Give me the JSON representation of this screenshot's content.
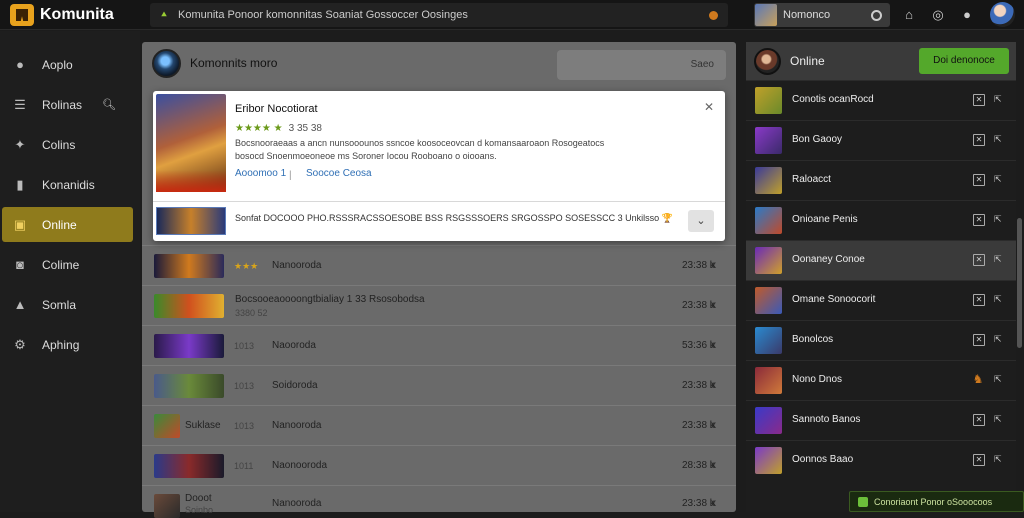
{
  "app": {
    "title": "Komunita"
  },
  "notice": {
    "lead": "⯅",
    "text": "Komunita Ponoor komonnitas Soaniat Gossoccer Oosinges"
  },
  "search": {
    "text": "Nomonco"
  },
  "sidebar": {
    "items": [
      {
        "label": "Aoplo",
        "icon": "apple-icon"
      },
      {
        "label": "Rolinas",
        "icon": "list-icon",
        "extra": "🔍︎"
      },
      {
        "label": "Colins",
        "icon": "bird-icon"
      },
      {
        "label": "Konanidis",
        "icon": "flag-icon"
      },
      {
        "label": "Online",
        "icon": "folder-icon"
      },
      {
        "label": "Colime",
        "icon": "camera-icon"
      },
      {
        "label": "Somla",
        "icon": "bell-icon"
      },
      {
        "label": "Aphing",
        "icon": "game-icon"
      }
    ]
  },
  "main": {
    "title": "Komonnits moro",
    "button": "Saeo"
  },
  "popup": {
    "title": "Eribor Nocotiorat",
    "rating": "★★★★ ★",
    "rating_num": "3 35 38",
    "desc": "Bocsnooraeaas a ancn nunsooounos ssncoe koosoceovcan d komansaaroaon  Rosogeatocs bosocd Snoenmoeoneoe ms Soroner Iocou Rooboano o oiooans.",
    "link1": "Aooomoo 1",
    "link2": "Soocoe Ceosa",
    "sep": "|",
    "sub_text": "Sonfat  DOCOOO PHO.RSSSRACSSOESOBE BSS RSGSSSOERS SRGOSSPO SOSESSCC 3 Unkilsso 🏆",
    "chev": "⌄"
  },
  "rows": [
    {
      "kind": "stars",
      "stars": "★★★",
      "name": "Nanooroda",
      "meta": "23:38 k",
      "x": ""
    },
    {
      "kind": "title",
      "title": "Bocsooeaoooongtbialiay 1 33 Rsosobodsa",
      "sub": "3380 52",
      "meta": "23:38 k",
      "x": "x"
    },
    {
      "kind": "rank",
      "rank": "1013",
      "name": "Naooroda",
      "meta": "53:36 k",
      "x": "x"
    },
    {
      "kind": "rank",
      "rank": "1013",
      "name": "Soidoroda",
      "meta": "23:38 k",
      "x": "x"
    },
    {
      "kind": "thumbtext",
      "thumb_label": "Suklase",
      "rank": "1013",
      "name": "Nanooroda",
      "meta": "23:38 k",
      "x": "x"
    },
    {
      "kind": "rank",
      "rank": "1011",
      "name": "Naonooroda",
      "meta": "28:38 k",
      "x": "x"
    },
    {
      "kind": "title",
      "title": "Dooot",
      "sub": "Soinbo",
      "name": "Nanooroda",
      "meta": "23:38 k",
      "x": "x"
    }
  ],
  "right": {
    "head_label": "Online",
    "head_button": "Doi denonoce",
    "items": [
      {
        "name": "Conotis ocanRocd"
      },
      {
        "name": "Bon Gaooy"
      },
      {
        "name": "Raloacct"
      },
      {
        "name": "Onioane Penis"
      },
      {
        "name": "Oonaney Conoe"
      },
      {
        "name": "Omane Sonoocorit"
      },
      {
        "name": "Bonolcos"
      },
      {
        "name": "Nono Dnos"
      },
      {
        "name": "Sannoto Banos"
      },
      {
        "name": "Oonnos Baao"
      }
    ]
  },
  "toast": {
    "text": "Conoriaont Ponor oSooocoos"
  },
  "colors": {
    "accent": "#8f7b1c",
    "green": "#54a82b",
    "orange": "#d07a1e"
  }
}
